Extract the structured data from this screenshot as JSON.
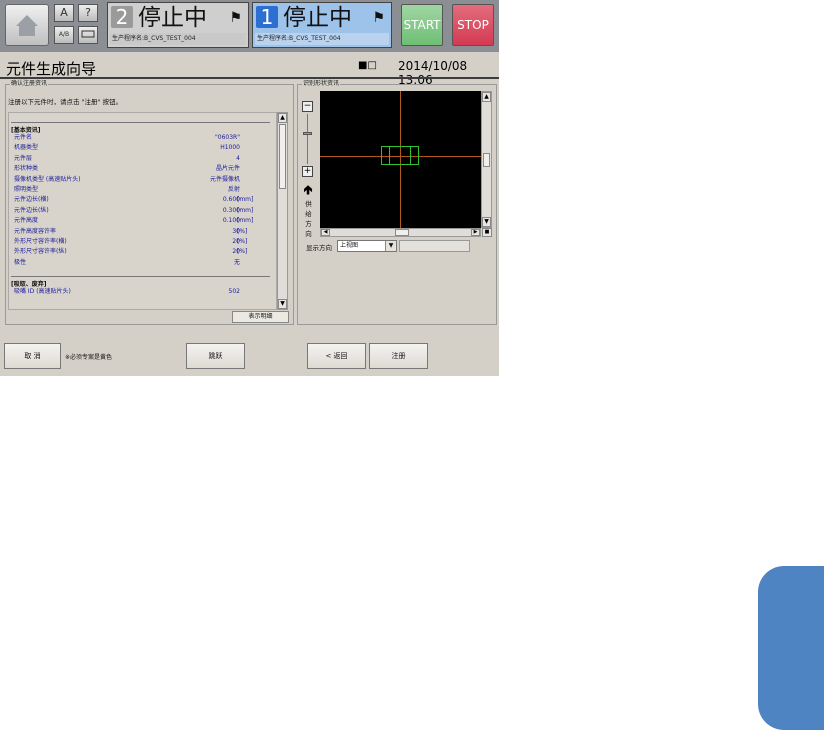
{
  "topbar": {
    "small_icon_1": "A",
    "small_icon_2": "?",
    "small_icon_3": "A/B",
    "line2": {
      "number": "2",
      "status": "停止中",
      "program": "生产程序名:B_CVS_TEST_004"
    },
    "line1": {
      "number": "1",
      "status": "停止中",
      "program": "生产程序名:B_CVS_TEST_004"
    },
    "start_label": "START",
    "stop_label": "STOP"
  },
  "header": {
    "title": "元件生成向导",
    "datetime": "2014/10/08 13:06"
  },
  "confirm": {
    "group_title": "确认注册资讯",
    "instruction": "注册以下元件时，请点击 \"注册\" 按钮。",
    "basic_section": "[基本资讯]",
    "rows": [
      {
        "k": "元件名",
        "v": "\"0603R\"",
        "u": ""
      },
      {
        "k": "机器类型",
        "v": "H1000",
        "u": ""
      },
      {
        "k": "元件层",
        "v": "4",
        "u": ""
      },
      {
        "k": "形状种类",
        "v": "晶片元件",
        "u": ""
      },
      {
        "k": "摄像机类型 (高速贴片头)",
        "v": "元件摄像机",
        "u": ""
      },
      {
        "k": "照明类型",
        "v": "反射",
        "u": ""
      },
      {
        "k": "元件边长(横)",
        "v": "0.600",
        "u": "[mm]"
      },
      {
        "k": "元件边长(纵)",
        "v": "0.300",
        "u": "[mm]"
      },
      {
        "k": "元件高度",
        "v": "0.100",
        "u": "[mm]"
      },
      {
        "k": "元件高度容许率",
        "v": "30",
        "u": "[%]"
      },
      {
        "k": "外形尺寸容许率(横)",
        "v": "20",
        "u": "[%]"
      },
      {
        "k": "外形尺寸容许率(纵)",
        "v": "20",
        "u": "[%]"
      },
      {
        "k": "极性",
        "v": "无",
        "u": ""
      }
    ],
    "pick_section": "[吸取、废弃]",
    "pick_rows": [
      {
        "k": "吸嘴 ID (高速贴片头)",
        "v": "502",
        "u": ""
      }
    ],
    "detail_button": "表示明细"
  },
  "shape": {
    "group_title": "识别形状资讯",
    "zoom_out": "−",
    "zoom_in": "+",
    "feed_chars": [
      "供",
      "给",
      "方",
      "向"
    ],
    "direction_label": "显示方向",
    "direction_value": "上视图"
  },
  "footer": {
    "cancel": "取 消",
    "note": "※必须专案是黄色",
    "skip": "跳跃",
    "back": "< 返回",
    "register": "注册"
  },
  "colors": {
    "start": "#6fbf74",
    "stop": "#d33a52",
    "line1_bg": "#9ec3ea",
    "side_tab": "#4e84c1"
  },
  "icons": [
    "home-icon",
    "operator-icon",
    "user-icon",
    "arrow-up-icon"
  ]
}
